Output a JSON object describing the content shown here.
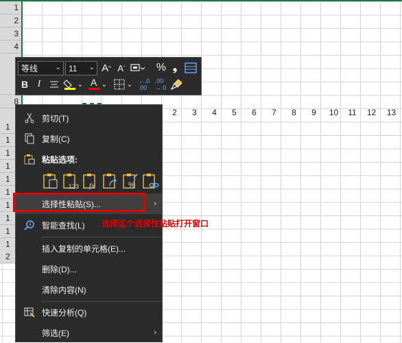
{
  "sheet": {
    "row_numbers_top": [
      "1",
      "2",
      "3",
      "4"
    ],
    "row_number_selected": "8",
    "row_numbers_partial": [
      "1",
      "1",
      "1",
      "1",
      "1",
      "1",
      "1",
      "1",
      "1",
      "1",
      "2"
    ],
    "column_labels": [
      "2",
      "3",
      "4",
      "5",
      "6",
      "7",
      "8",
      "9",
      "10",
      "11",
      "12",
      "13"
    ]
  },
  "mini_toolbar": {
    "font_name": "等线",
    "font_size": "11",
    "icons": [
      "increase-font-size",
      "decrease-font-size",
      "number-format",
      "percent",
      "comma-style",
      "format-painter-table",
      "bold",
      "italic",
      "align-center",
      "fill-color",
      "font-color",
      "borders",
      "increase-decimal",
      "decrease-decimal",
      "format-painter"
    ],
    "bold_label": "B",
    "italic_label": "I",
    "percent_label": "%",
    "comma_label": "❟",
    "grow_font_label": "A",
    "shrink_font_label": "A",
    "font_color_label": "A",
    "fill_color": "#ffff00",
    "font_color": "#ff0000"
  },
  "context_menu": {
    "items": [
      {
        "label": "剪切(T)",
        "icon": "scissors-icon"
      },
      {
        "label": "复制(C)",
        "icon": "copy-icon"
      },
      {
        "label": "粘贴选项:",
        "icon": "clipboard-icon"
      },
      {
        "label": "选择性粘贴(S)...",
        "icon": ""
      },
      {
        "label": "智能查找(L)",
        "icon": "smart-lookup-icon"
      },
      {
        "label": "插入复制的单元格(E)...",
        "icon": ""
      },
      {
        "label": "删除(D)...",
        "icon": ""
      },
      {
        "label": "清除内容(N)",
        "icon": ""
      },
      {
        "label": "快速分析(Q)",
        "icon": "quick-analysis-icon"
      },
      {
        "label": "筛选(E)",
        "icon": ""
      }
    ],
    "paste_options": [
      "paste",
      "paste-values",
      "paste-formulas",
      "paste-transpose",
      "paste-formatting",
      "paste-link"
    ]
  },
  "annotation": {
    "text": "选择这个选择性粘贴打开窗口",
    "color": "#e00000"
  }
}
